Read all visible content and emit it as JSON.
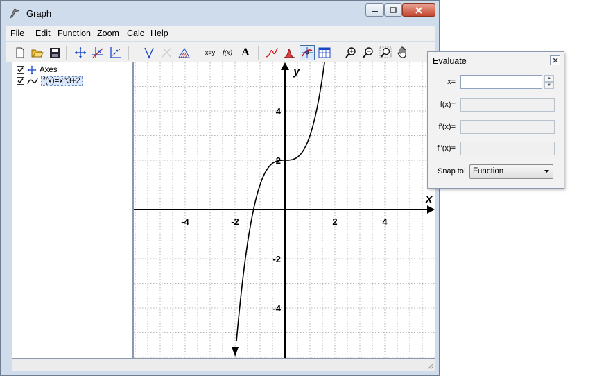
{
  "window": {
    "title": "Graph"
  },
  "menu": {
    "items": [
      {
        "ul": "F",
        "rest": "ile"
      },
      {
        "ul": "E",
        "rest": "dit"
      },
      {
        "ul": "F",
        "rest": "unction"
      },
      {
        "ul": "Z",
        "rest": "oom"
      },
      {
        "ul": "C",
        "rest": "alc"
      },
      {
        "ul": "H",
        "rest": "elp"
      }
    ]
  },
  "toolbar": {
    "text_xy": "x=y",
    "text_fx": "f(x)",
    "text_a": "A"
  },
  "function_list": [
    {
      "label": "Axes",
      "checked": true,
      "icon": "axes-icon"
    },
    {
      "label": "f(x)=x^3+2",
      "checked": true,
      "icon": "curve-icon",
      "selected": true
    }
  ],
  "graph": {
    "axis_x_label": "x",
    "axis_y_label": "y",
    "x_ticks": [
      {
        "v": -4,
        "label": "-4"
      },
      {
        "v": -2,
        "label": "-2"
      },
      {
        "v": 2,
        "label": "2"
      },
      {
        "v": 4,
        "label": "4"
      }
    ],
    "y_ticks": [
      {
        "v": 4,
        "label": "4"
      },
      {
        "v": 2,
        "label": "2"
      },
      {
        "v": -2,
        "label": "-2"
      },
      {
        "v": -4,
        "label": "-4"
      }
    ],
    "function": "x^3+2",
    "curve_color": "#000000",
    "grid": true
  },
  "evaluate": {
    "title": "Evaluate",
    "x_label": "x=",
    "x_value": "",
    "fx_label": "f(x)=",
    "fpx_label": "f'(x)=",
    "fppx_label": "f''(x)=",
    "snap_label": "Snap to:",
    "snap_value": "Function"
  }
}
